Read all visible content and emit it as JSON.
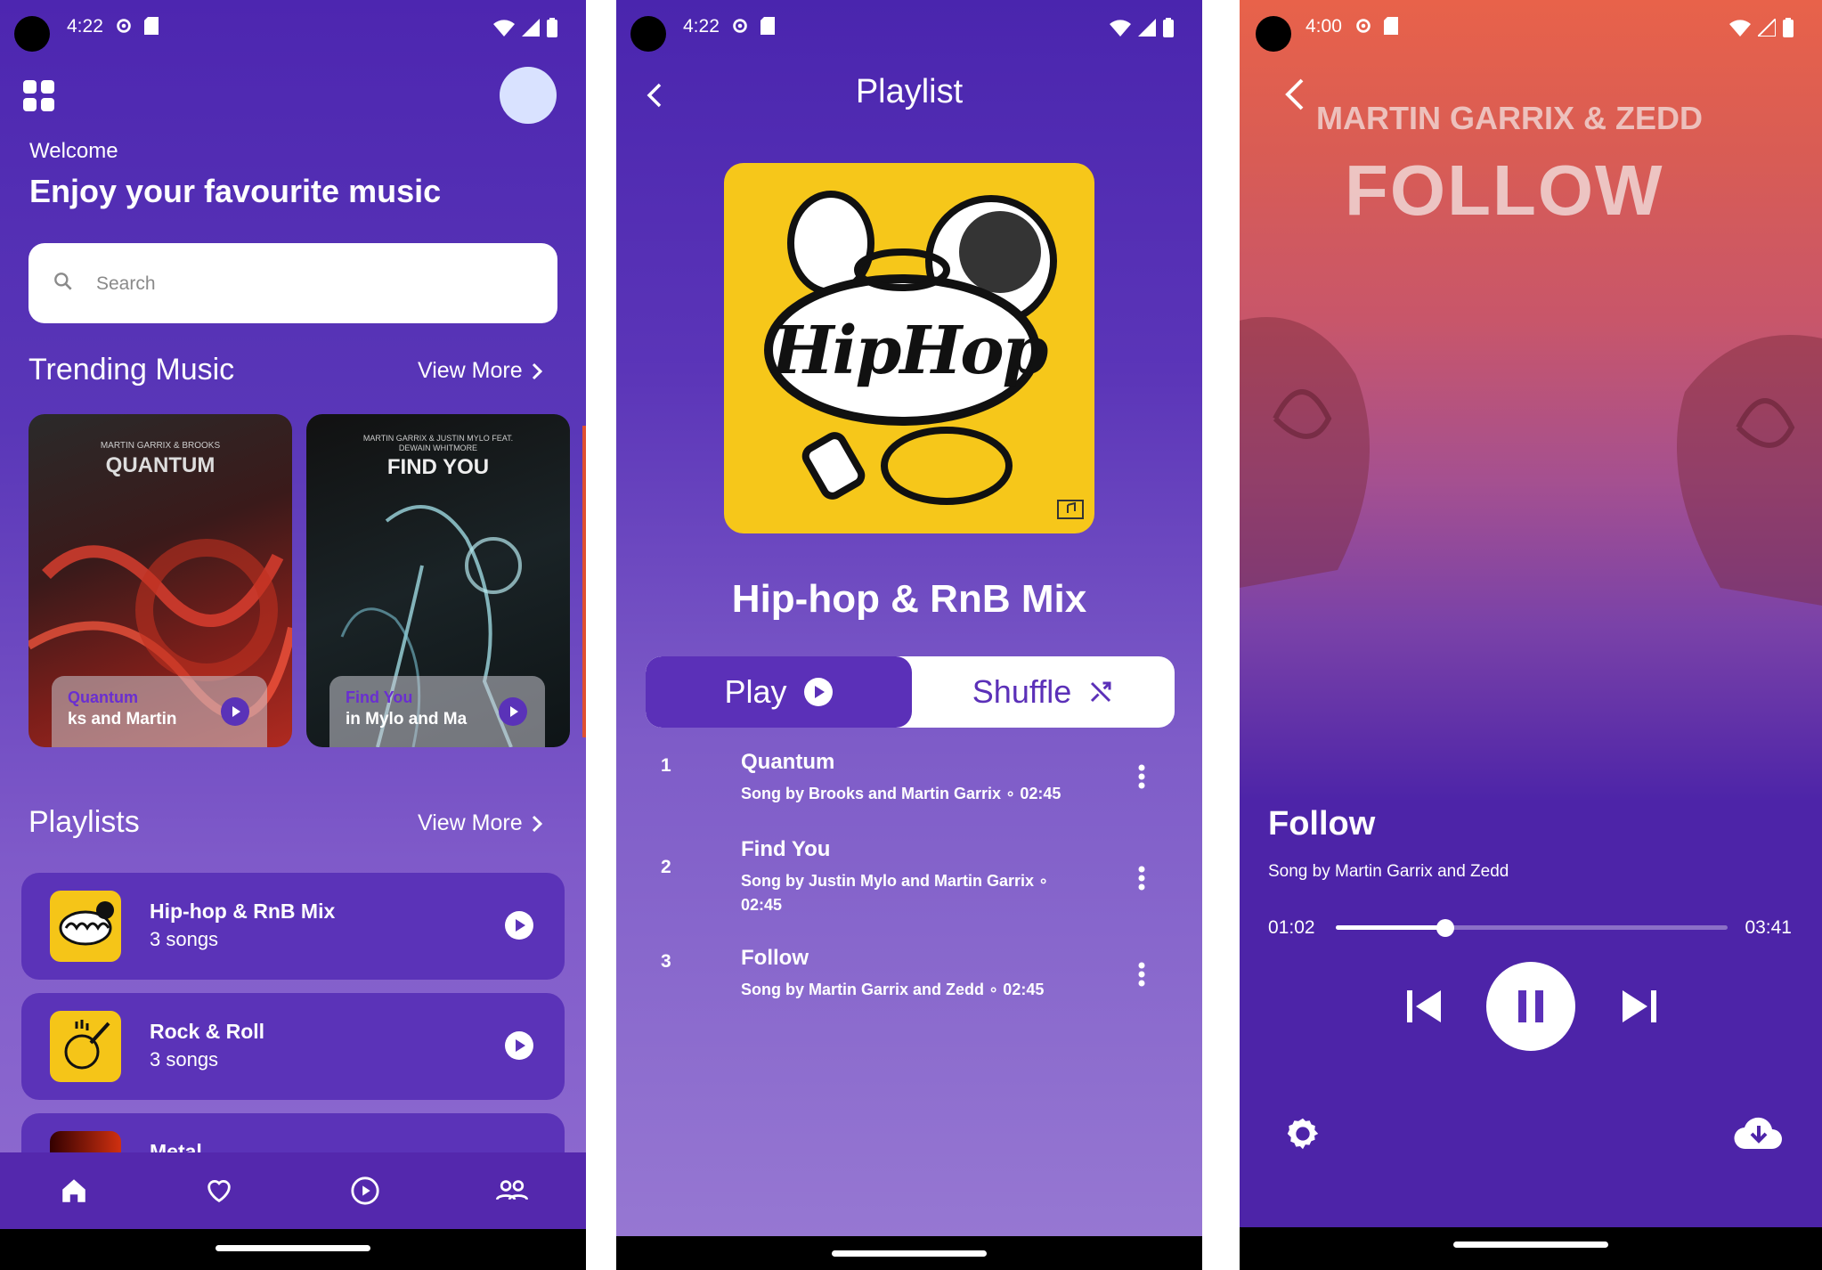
{
  "screen1": {
    "status": {
      "time": "4:22"
    },
    "welcome": "Welcome",
    "headline": "Enjoy your favourite music",
    "search": {
      "placeholder": "Search"
    },
    "trending": {
      "title": "Trending Music",
      "view_more": "View More",
      "cards": [
        {
          "art_artist": "MARTIN GARRIX & BROOKS",
          "art_title": "QUANTUM",
          "title": "Quantum",
          "subtitle": "ks and Martin"
        },
        {
          "art_artist": "MARTIN GARRIX & JUSTIN MYLO FEAT. DEWAIN WHITMORE",
          "art_title": "FIND YOU",
          "title": "Find You",
          "subtitle": "in Mylo and Ma"
        }
      ]
    },
    "playlists": {
      "title": "Playlists",
      "view_more": "View More",
      "items": [
        {
          "name": "Hip-hop & RnB Mix",
          "count": "3 songs"
        },
        {
          "name": "Rock & Roll",
          "count": "3 songs"
        },
        {
          "name": "Metal",
          "count": ""
        }
      ]
    },
    "nav": [
      "home-icon",
      "heart-icon",
      "play-circle-icon",
      "people-icon"
    ]
  },
  "screen2": {
    "status": {
      "time": "4:22"
    },
    "title": "Playlist",
    "mix_name": "Hip-hop & RnB Mix",
    "art_text": "HipHop",
    "play_label": "Play",
    "shuffle_label": "Shuffle",
    "tracks": [
      {
        "num": "1",
        "title": "Quantum",
        "sub": "Song by Brooks and Martin Garrix ∘ 02:45"
      },
      {
        "num": "2",
        "title": "Find You",
        "sub": "Song by Justin Mylo and Martin Garrix ∘ 02:45"
      },
      {
        "num": "3",
        "title": "Follow",
        "sub": "Song by Martin Garrix and Zedd ∘ 02:45"
      }
    ]
  },
  "screen3": {
    "status": {
      "time": "4:00"
    },
    "cover_artist": "MARTIN GARRIX & ZEDD",
    "cover_title": "FOLLOW",
    "song": "Follow",
    "artist": "Song by Martin Garrix and Zedd",
    "current_time": "01:02",
    "total_time": "03:41",
    "progress": 0.28
  },
  "colors": {
    "accent": "#5b30b8",
    "background_top": "#4d26b0",
    "art_yellow": "#f6c71a"
  }
}
